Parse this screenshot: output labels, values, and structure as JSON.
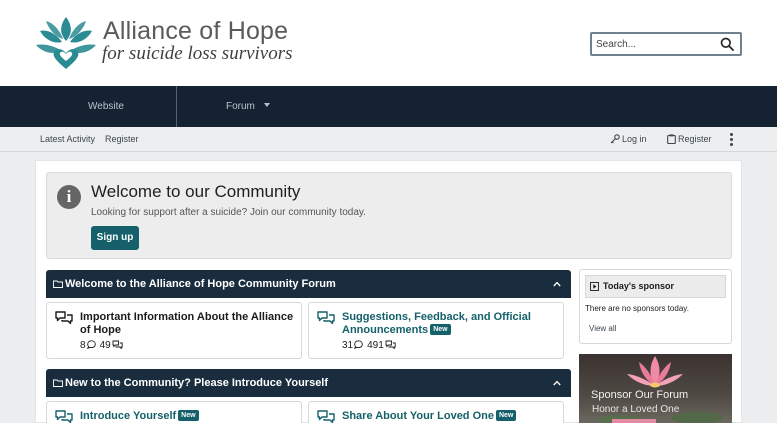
{
  "brand": {
    "title": "Alliance of Hope",
    "subtitle": "for suicide loss survivors",
    "logo_icon": "lotus-heart-icon",
    "logo_color": "#2a8b92"
  },
  "search": {
    "placeholder": "Search..."
  },
  "nav": {
    "tabs": [
      {
        "label": "Website"
      },
      {
        "label": "Forum"
      }
    ]
  },
  "subnav": {
    "links": [
      "Latest Activity",
      "Register"
    ],
    "login_label": "Log in",
    "register_label": "Register"
  },
  "notice": {
    "title": "Welcome to our Community",
    "text": "Looking for support after a suicide? Join our community today.",
    "button_label": "Sign up"
  },
  "categories": [
    {
      "title": "Welcome to the Alliance of Hope Community Forum",
      "forums": [
        {
          "title": "Important Information About the Alliance of Hope",
          "is_new": false,
          "threads": "8",
          "messages": "49"
        },
        {
          "title": "Suggestions, Feedback, and Official Announcements",
          "is_new": true,
          "threads": "31",
          "messages": "491"
        }
      ]
    },
    {
      "title": "New to the Community? Please Introduce Yourself",
      "forums": [
        {
          "title": "Introduce Yourself",
          "is_new": true
        },
        {
          "title": "Share About Your Loved One",
          "is_new": true
        }
      ]
    }
  ],
  "badge_new": "New",
  "sidebar": {
    "sponsor_title": "Today's sponsor",
    "no_sponsors": "There are no sponsors today.",
    "view_all": "View all",
    "promo_title": "Sponsor Our Forum",
    "promo_subtitle": "Honor a Loved One"
  },
  "colors": {
    "navbar": "#142231",
    "category_header": "#1a2d3e",
    "accent_teal": "#15606a"
  }
}
